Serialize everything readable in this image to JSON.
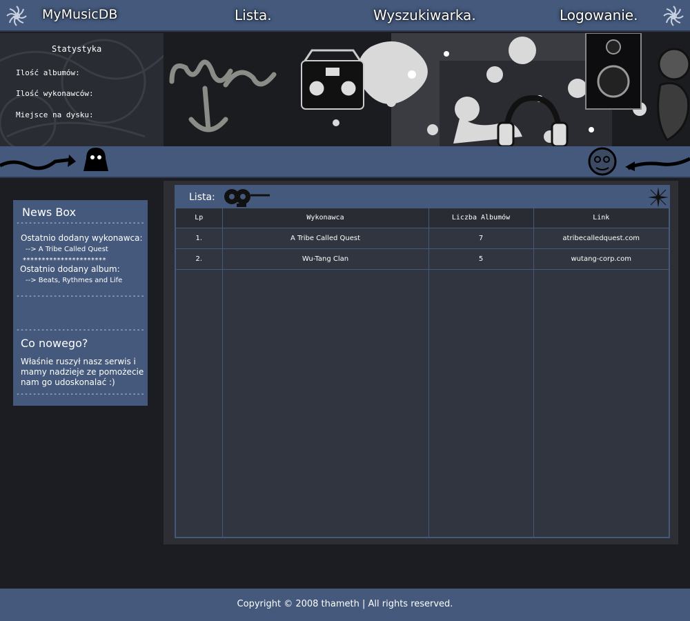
{
  "nav": {
    "brand": "MyMusicDB",
    "items": [
      "Lista.",
      "Wyszukiwarka.",
      "Logowanie."
    ]
  },
  "stats": {
    "title": "Statystyka",
    "rows": [
      "Ilość albumów:",
      "Ilość wykonawców:",
      "Miejsce na dysku:"
    ]
  },
  "news": {
    "title": "News Box",
    "last_artist_label": "Ostatnio dodany wykonawca:",
    "last_artist": "--> A Tribe Called Quest",
    "separator_stars": "**********************",
    "last_album_label": "Ostatnio dodany album:",
    "last_album": "--> Beats, Rythmes and Life",
    "dashes": "-------------------------------",
    "whats_new_title": "Co nowego?",
    "whats_new_text": "Właśnie ruszył nasz serwis i mamy nadzieje ze pomożecie nam go udoskonalać :)"
  },
  "list": {
    "title": "Lista:",
    "columns": [
      "Lp",
      "Wykonawca",
      "Liczba Albumów",
      "Link"
    ],
    "rows": [
      {
        "lp": "1.",
        "artist": "A Tribe Called Quest",
        "albums": "7",
        "link": "atribecalledquest.com"
      },
      {
        "lp": "2.",
        "artist": "Wu-Tang Clan",
        "albums": "5",
        "link": "wutang-corp.com"
      }
    ]
  },
  "footer": {
    "text": "Copyright © 2008 thameth | All rights reserved."
  },
  "colors": {
    "accent": "#44597c",
    "background": "#1c1d22",
    "panel": "#31353f"
  }
}
